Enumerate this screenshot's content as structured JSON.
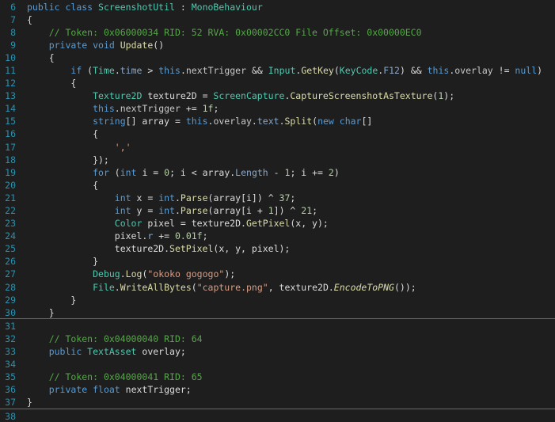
{
  "editor": {
    "lines": [
      {
        "n": "6",
        "tokens": [
          [
            "kw",
            "public "
          ],
          [
            "kw",
            "class "
          ],
          [
            "type",
            "ScreenshotUtil"
          ],
          [
            "plain",
            " : "
          ],
          [
            "type",
            "MonoBehaviour"
          ]
        ]
      },
      {
        "n": "7",
        "tokens": [
          [
            "plain",
            "{"
          ]
        ]
      },
      {
        "n": "8",
        "tokens": [
          [
            "plain",
            "    "
          ],
          [
            "comment",
            "// Token: 0x06000034 RID: 52 RVA: 0x00002CC0 File Offset: 0x00000EC0"
          ]
        ]
      },
      {
        "n": "9",
        "tokens": [
          [
            "plain",
            "    "
          ],
          [
            "kw",
            "private "
          ],
          [
            "kw",
            "void "
          ],
          [
            "method",
            "Update"
          ],
          [
            "plain",
            "()"
          ]
        ]
      },
      {
        "n": "10",
        "tokens": [
          [
            "plain",
            "    {"
          ]
        ]
      },
      {
        "n": "11",
        "tokens": [
          [
            "plain",
            "        "
          ],
          [
            "kw",
            "if "
          ],
          [
            "plain",
            "("
          ],
          [
            "type",
            "Time"
          ],
          [
            "plain",
            "."
          ],
          [
            "prop",
            "time"
          ],
          [
            "plain",
            " > "
          ],
          [
            "kw",
            "this"
          ],
          [
            "plain",
            "."
          ],
          [
            "field",
            "nextTrigger"
          ],
          [
            "plain",
            " && "
          ],
          [
            "type",
            "Input"
          ],
          [
            "plain",
            "."
          ],
          [
            "method",
            "GetKey"
          ],
          [
            "plain",
            "("
          ],
          [
            "type",
            "KeyCode"
          ],
          [
            "plain",
            "."
          ],
          [
            "prop",
            "F12"
          ],
          [
            "plain",
            ") && "
          ],
          [
            "kw",
            "this"
          ],
          [
            "plain",
            "."
          ],
          [
            "field",
            "overlay"
          ],
          [
            "plain",
            " != "
          ],
          [
            "kw",
            "null"
          ],
          [
            "plain",
            ")"
          ]
        ]
      },
      {
        "n": "12",
        "tokens": [
          [
            "plain",
            "        {"
          ]
        ]
      },
      {
        "n": "13",
        "tokens": [
          [
            "plain",
            "            "
          ],
          [
            "type",
            "Texture2D"
          ],
          [
            "plain",
            " texture2D = "
          ],
          [
            "type",
            "ScreenCapture"
          ],
          [
            "plain",
            "."
          ],
          [
            "method",
            "CaptureScreenshotAsTexture"
          ],
          [
            "plain",
            "("
          ],
          [
            "num",
            "1"
          ],
          [
            "plain",
            ");"
          ]
        ]
      },
      {
        "n": "14",
        "tokens": [
          [
            "plain",
            "            "
          ],
          [
            "kw",
            "this"
          ],
          [
            "plain",
            "."
          ],
          [
            "field",
            "nextTrigger"
          ],
          [
            "plain",
            " += "
          ],
          [
            "num",
            "1f"
          ],
          [
            "plain",
            ";"
          ]
        ]
      },
      {
        "n": "15",
        "tokens": [
          [
            "plain",
            "            "
          ],
          [
            "kw",
            "string"
          ],
          [
            "plain",
            "[] array = "
          ],
          [
            "kw",
            "this"
          ],
          [
            "plain",
            "."
          ],
          [
            "field",
            "overlay"
          ],
          [
            "plain",
            "."
          ],
          [
            "prop",
            "text"
          ],
          [
            "plain",
            "."
          ],
          [
            "method",
            "Split"
          ],
          [
            "plain",
            "("
          ],
          [
            "kw",
            "new "
          ],
          [
            "kw",
            "char"
          ],
          [
            "plain",
            "[]"
          ]
        ]
      },
      {
        "n": "16",
        "tokens": [
          [
            "plain",
            "            {"
          ]
        ]
      },
      {
        "n": "17",
        "tokens": [
          [
            "plain",
            "                "
          ],
          [
            "str",
            "','"
          ]
        ]
      },
      {
        "n": "18",
        "tokens": [
          [
            "plain",
            "            });"
          ]
        ]
      },
      {
        "n": "19",
        "tokens": [
          [
            "plain",
            "            "
          ],
          [
            "kw",
            "for "
          ],
          [
            "plain",
            "("
          ],
          [
            "kw",
            "int"
          ],
          [
            "plain",
            " i = "
          ],
          [
            "num",
            "0"
          ],
          [
            "plain",
            "; i < array."
          ],
          [
            "prop",
            "Length"
          ],
          [
            "plain",
            " - "
          ],
          [
            "num",
            "1"
          ],
          [
            "plain",
            "; i += "
          ],
          [
            "num",
            "2"
          ],
          [
            "plain",
            ")"
          ]
        ]
      },
      {
        "n": "20",
        "tokens": [
          [
            "plain",
            "            {"
          ]
        ]
      },
      {
        "n": "21",
        "tokens": [
          [
            "plain",
            "                "
          ],
          [
            "kw",
            "int"
          ],
          [
            "plain",
            " x = "
          ],
          [
            "kw",
            "int"
          ],
          [
            "plain",
            "."
          ],
          [
            "method",
            "Parse"
          ],
          [
            "plain",
            "(array[i]) ^ "
          ],
          [
            "num",
            "37"
          ],
          [
            "plain",
            ";"
          ]
        ]
      },
      {
        "n": "22",
        "tokens": [
          [
            "plain",
            "                "
          ],
          [
            "kw",
            "int"
          ],
          [
            "plain",
            " y = "
          ],
          [
            "kw",
            "int"
          ],
          [
            "plain",
            "."
          ],
          [
            "method",
            "Parse"
          ],
          [
            "plain",
            "(array[i + "
          ],
          [
            "num",
            "1"
          ],
          [
            "plain",
            "]) ^ "
          ],
          [
            "num",
            "21"
          ],
          [
            "plain",
            ";"
          ]
        ]
      },
      {
        "n": "23",
        "tokens": [
          [
            "plain",
            "                "
          ],
          [
            "type",
            "Color"
          ],
          [
            "plain",
            " pixel = texture2D."
          ],
          [
            "method",
            "GetPixel"
          ],
          [
            "plain",
            "(x, y);"
          ]
        ]
      },
      {
        "n": "24",
        "tokens": [
          [
            "plain",
            "                pixel."
          ],
          [
            "prop",
            "r"
          ],
          [
            "plain",
            " += "
          ],
          [
            "num",
            "0.01f"
          ],
          [
            "plain",
            ";"
          ]
        ]
      },
      {
        "n": "25",
        "tokens": [
          [
            "plain",
            "                texture2D."
          ],
          [
            "method",
            "SetPixel"
          ],
          [
            "plain",
            "(x, y, pixel);"
          ]
        ]
      },
      {
        "n": "26",
        "tokens": [
          [
            "plain",
            "            }"
          ]
        ]
      },
      {
        "n": "27",
        "tokens": [
          [
            "plain",
            "            "
          ],
          [
            "type",
            "Debug"
          ],
          [
            "plain",
            "."
          ],
          [
            "method",
            "Log"
          ],
          [
            "plain",
            "("
          ],
          [
            "str",
            "\"okoko gogogo\""
          ],
          [
            "plain",
            ");"
          ]
        ]
      },
      {
        "n": "28",
        "tokens": [
          [
            "plain",
            "            "
          ],
          [
            "type",
            "File"
          ],
          [
            "plain",
            "."
          ],
          [
            "method",
            "WriteAllBytes"
          ],
          [
            "plain",
            "("
          ],
          [
            "str",
            "\"capture.png\""
          ],
          [
            "plain",
            ", texture2D."
          ],
          [
            "ital",
            "EncodeToPNG"
          ],
          [
            "plain",
            "());"
          ]
        ]
      },
      {
        "n": "29",
        "tokens": [
          [
            "plain",
            "        }"
          ]
        ]
      },
      {
        "n": "30",
        "tokens": [
          [
            "plain",
            "    }"
          ]
        ]
      },
      {
        "n": "31",
        "tokens": []
      },
      {
        "n": "32",
        "tokens": [
          [
            "plain",
            "    "
          ],
          [
            "comment",
            "// Token: 0x04000040 RID: 64"
          ]
        ]
      },
      {
        "n": "33",
        "tokens": [
          [
            "plain",
            "    "
          ],
          [
            "kw",
            "public "
          ],
          [
            "type",
            "TextAsset"
          ],
          [
            "plain",
            " overlay;"
          ]
        ]
      },
      {
        "n": "34",
        "tokens": []
      },
      {
        "n": "35",
        "tokens": [
          [
            "plain",
            "    "
          ],
          [
            "comment",
            "// Token: 0x04000041 RID: 65"
          ]
        ]
      },
      {
        "n": "36",
        "tokens": [
          [
            "plain",
            "    "
          ],
          [
            "kw",
            "private "
          ],
          [
            "kw",
            "float "
          ],
          [
            "plain",
            "nextTrigger;"
          ]
        ]
      },
      {
        "n": "37",
        "tokens": [
          [
            "plain",
            "}"
          ]
        ]
      },
      {
        "n": "38",
        "tokens": []
      }
    ]
  }
}
